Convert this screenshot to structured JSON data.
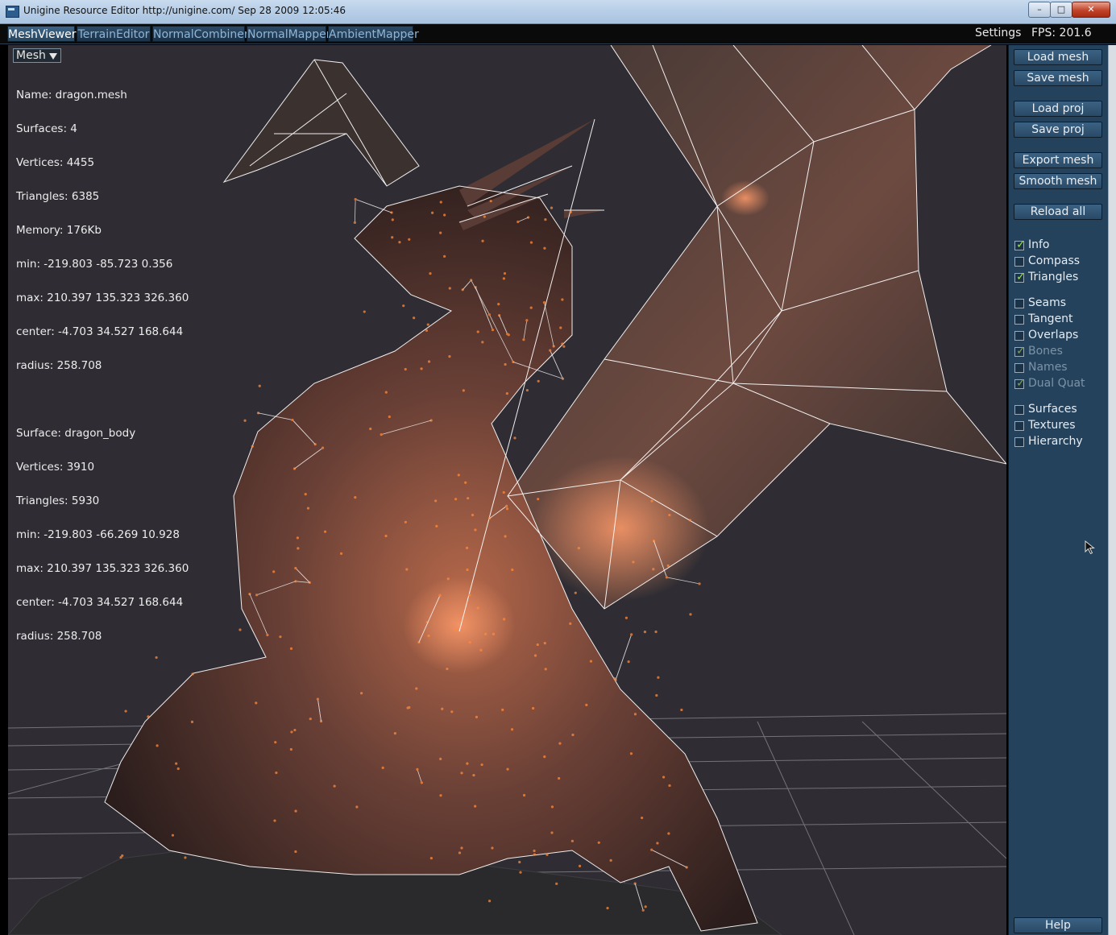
{
  "window": {
    "title": "Unigine Resource Editor http://unigine.com/ Sep 28 2009 12:05:46",
    "controls": {
      "minimize": "–",
      "maximize": "□",
      "close": "✕"
    }
  },
  "tabs": [
    {
      "label": "MeshViewer",
      "active": true
    },
    {
      "label": "TerrainEditor",
      "active": false
    },
    {
      "label": "NormalCombiner",
      "active": false
    },
    {
      "label": "NormalMapper",
      "active": false
    },
    {
      "label": "AmbientMapper",
      "active": false
    }
  ],
  "topbar": {
    "settings": "Settings",
    "fps": "FPS: 201.6"
  },
  "viewport": {
    "mode_dropdown": "Mesh",
    "info_lines": [
      "Name: dragon.mesh",
      "Surfaces: 4",
      "Vertices: 4455",
      "Triangles: 6385",
      "Memory: 176Kb",
      "min: -219.803 -85.723 0.356",
      "max: 210.397 135.323 326.360",
      "center: -4.703 34.527 168.644",
      "radius: 258.708",
      "",
      "Surface: dragon_body",
      "Vertices: 3910",
      "Triangles: 5930",
      "min: -219.803 -66.269 10.928",
      "max: 210.397 135.323 326.360",
      "center: -4.703 34.527 168.644",
      "radius: 258.708"
    ]
  },
  "panel": {
    "buttons": {
      "load_mesh": "Load mesh",
      "save_mesh": "Save mesh",
      "load_proj": "Load proj",
      "save_proj": "Save proj",
      "export_mesh": "Export mesh",
      "smooth_mesh": "Smooth mesh",
      "reload_all": "Reload all",
      "help": "Help"
    },
    "checkboxes": [
      {
        "label": "Info",
        "checked": true,
        "enabled": true
      },
      {
        "label": "Compass",
        "checked": false,
        "enabled": true
      },
      {
        "label": "Triangles",
        "checked": true,
        "enabled": true
      },
      {
        "label": "Seams",
        "checked": false,
        "enabled": true
      },
      {
        "label": "Tangent",
        "checked": false,
        "enabled": true
      },
      {
        "label": "Overlaps",
        "checked": false,
        "enabled": true
      },
      {
        "label": "Bones",
        "checked": true,
        "enabled": false
      },
      {
        "label": "Names",
        "checked": false,
        "enabled": false
      },
      {
        "label": "Dual Quat",
        "checked": true,
        "enabled": false
      },
      {
        "label": "Surfaces",
        "checked": false,
        "enabled": true
      },
      {
        "label": "Textures",
        "checked": false,
        "enabled": true
      },
      {
        "label": "Hierarchy",
        "checked": false,
        "enabled": true
      }
    ]
  },
  "colors": {
    "viewport_bg": "#2f2d33",
    "panel_bg": "#24425b",
    "wire": "#ffffff",
    "check_tick": "#99e04a"
  }
}
